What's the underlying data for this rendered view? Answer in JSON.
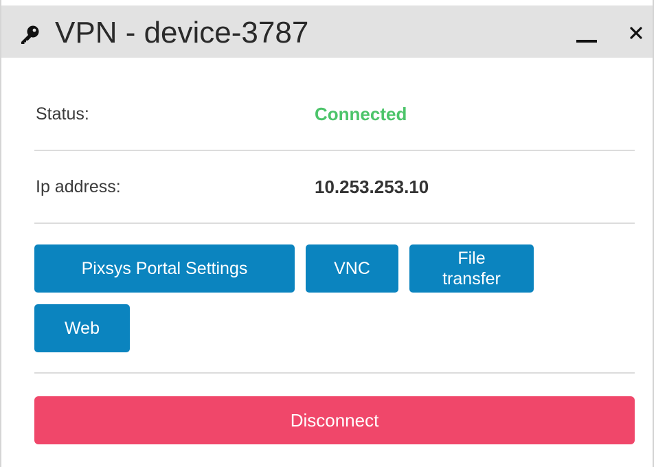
{
  "window": {
    "title": "VPN - device-3787",
    "title_icon": "key-icon",
    "minimize_icon": "minimize-icon",
    "close_icon": "close-icon",
    "close_glyph": "×"
  },
  "status": {
    "label": "Status:",
    "value": "Connected",
    "value_color": "#4cc46a"
  },
  "ip": {
    "label": "Ip address:",
    "value": "10.253.253.10"
  },
  "buttons": {
    "portal_settings": "Pixsys Portal Settings",
    "vnc": "VNC",
    "file_transfer": "File transfer",
    "web": "Web",
    "disconnect": "Disconnect"
  },
  "colors": {
    "accent": "#0b84bf",
    "danger": "#f0476a",
    "titlebar": "#e2e2e2"
  }
}
